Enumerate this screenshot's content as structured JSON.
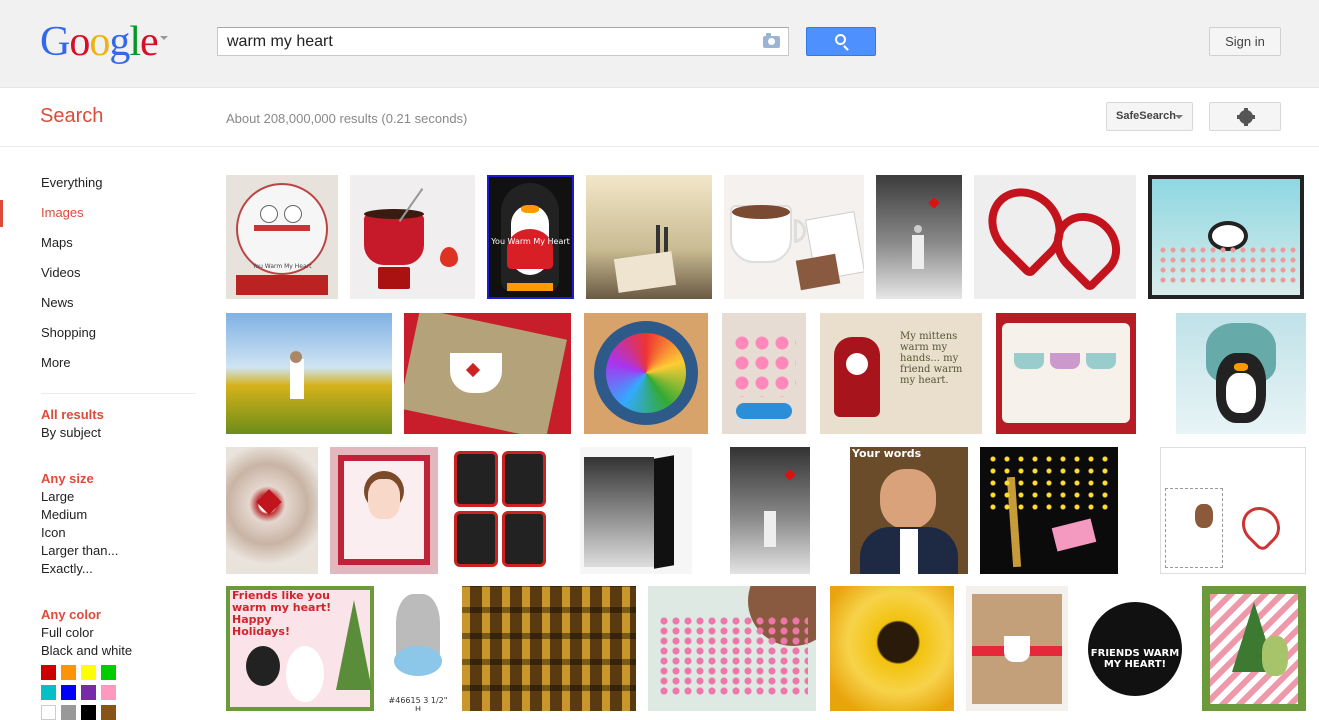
{
  "header": {
    "logo_letters": [
      {
        "ch": "G",
        "color": "#3369e8"
      },
      {
        "ch": "o",
        "color": "#d50f25"
      },
      {
        "ch": "o",
        "color": "#eeb211"
      },
      {
        "ch": "g",
        "color": "#3369e8"
      },
      {
        "ch": "l",
        "color": "#009925"
      },
      {
        "ch": "e",
        "color": "#d50f25"
      }
    ],
    "search_query": "warm my heart",
    "sign_in_label": "Sign in"
  },
  "subheader": {
    "search_label": "Search",
    "result_stats": "About 208,000,000 results (0.21 seconds)",
    "safesearch_label": "SafeSearch"
  },
  "sidebar": {
    "nav_items": [
      "Everything",
      "Images",
      "Maps",
      "Videos",
      "News",
      "Shopping",
      "More"
    ],
    "active_item": "Images",
    "results_group": {
      "selected": "All results",
      "other": "By subject"
    },
    "size_group": {
      "heading": "Any size",
      "items": [
        "Large",
        "Medium",
        "Icon",
        "Larger than...",
        "Exactly..."
      ]
    },
    "color_group": {
      "heading": "Any color",
      "items": [
        "Full color",
        "Black and white"
      ]
    },
    "swatches": [
      "#cc0000",
      "#fb940b",
      "#ffff00",
      "#00cc00",
      "#03c0c6",
      "#0000ff",
      "#762ca7",
      "#ff98bf",
      "#ffffff",
      "#999999",
      "#000000",
      "#885418"
    ]
  },
  "images": {
    "captions": {
      "snowglobe": "You Warm My Heart",
      "penguin": "You Warm My Heart",
      "pillow": "My mittens warm my hands... my friend warm my heart.",
      "politician": "Your words",
      "friends_card": "Friends like you warm my heart! Happy Holidays!",
      "stamp_number": "#46615 3 1/2\" H",
      "badge": "FRIENDS WARM MY HEART!"
    }
  }
}
